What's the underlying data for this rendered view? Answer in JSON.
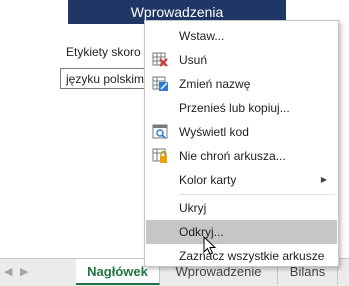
{
  "sheet": {
    "banner_title": "Wprowadzenia",
    "label_etykiety": "Etykiety skoro",
    "combo_value": "języku polskim"
  },
  "tabs": [
    {
      "label": "Nagłówek",
      "active": true
    },
    {
      "label": "Wprowadzenie",
      "active": false
    },
    {
      "label": "Bilans",
      "active": false
    }
  ],
  "context_menu": {
    "items": [
      {
        "label": "Wstaw...",
        "icon": ""
      },
      {
        "label": "Usuń",
        "icon": "delete-sheet-icon"
      },
      {
        "label": "Zmień nazwę",
        "icon": "rename-sheet-icon"
      },
      {
        "label": "Przenieś lub kopiuj...",
        "icon": ""
      },
      {
        "label": "Wyświetl kod",
        "icon": "view-code-icon"
      },
      {
        "label": "Nie chroń arkusza...",
        "icon": "unprotect-sheet-icon"
      },
      {
        "label": "Kolor karty",
        "icon": "",
        "submenu": true
      },
      {
        "label": "Ukryj",
        "icon": ""
      },
      {
        "label": "Odkryj...",
        "icon": "",
        "hovered": true
      },
      {
        "label": "Zaznacz wszystkie arkusze",
        "icon": ""
      }
    ]
  },
  "colors": {
    "banner_bg": "#1e3765",
    "active_tab_text": "#217346",
    "menu_hover": "#c6c6c6"
  }
}
